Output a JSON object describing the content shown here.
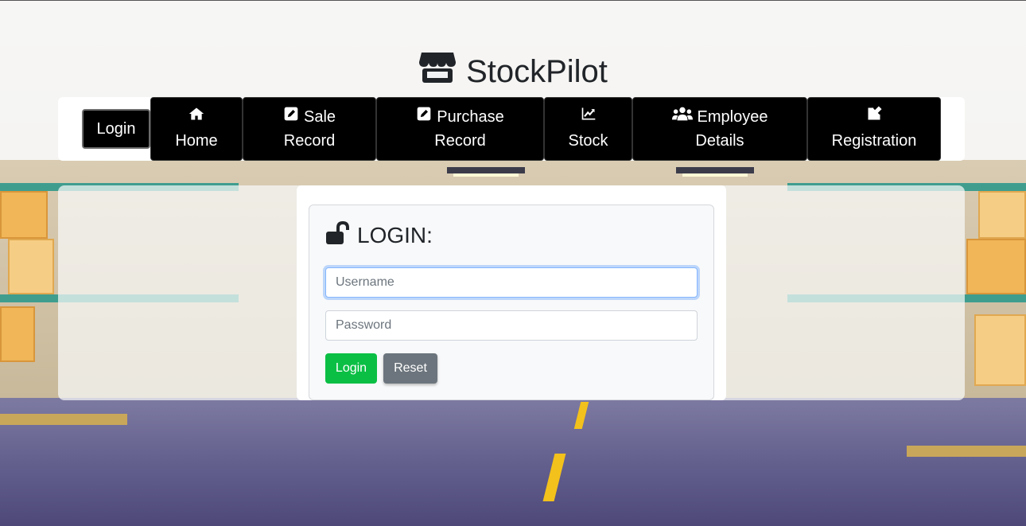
{
  "brand": {
    "icon": "store-icon",
    "name": "StockPilot"
  },
  "nav": {
    "login_label": "Login",
    "items": [
      {
        "icon": "home-icon",
        "line1": "",
        "line2": "Home"
      },
      {
        "icon": "edit-square-icon",
        "line1": "Sale",
        "line2": "Record"
      },
      {
        "icon": "edit-square-icon",
        "line1": "Purchase",
        "line2": "Record"
      },
      {
        "icon": "chart-line-icon",
        "line1": "",
        "line2": "Stock"
      },
      {
        "icon": "users-icon",
        "line1": "Employee",
        "line2": "Details"
      },
      {
        "icon": "edit-pencil-icon",
        "line1": "",
        "line2": "Registration"
      }
    ]
  },
  "login_form": {
    "icon": "unlock-icon",
    "title": "LOGIN:",
    "username": {
      "value": "",
      "placeholder": "Username"
    },
    "password": {
      "value": "",
      "placeholder": "Password"
    },
    "login_button": "Login",
    "reset_button": "Reset"
  },
  "colors": {
    "nav_bg": "#000000",
    "login_button": "#0bbf45",
    "reset_button": "#6c757d",
    "focus_ring": "#86b7fe"
  }
}
